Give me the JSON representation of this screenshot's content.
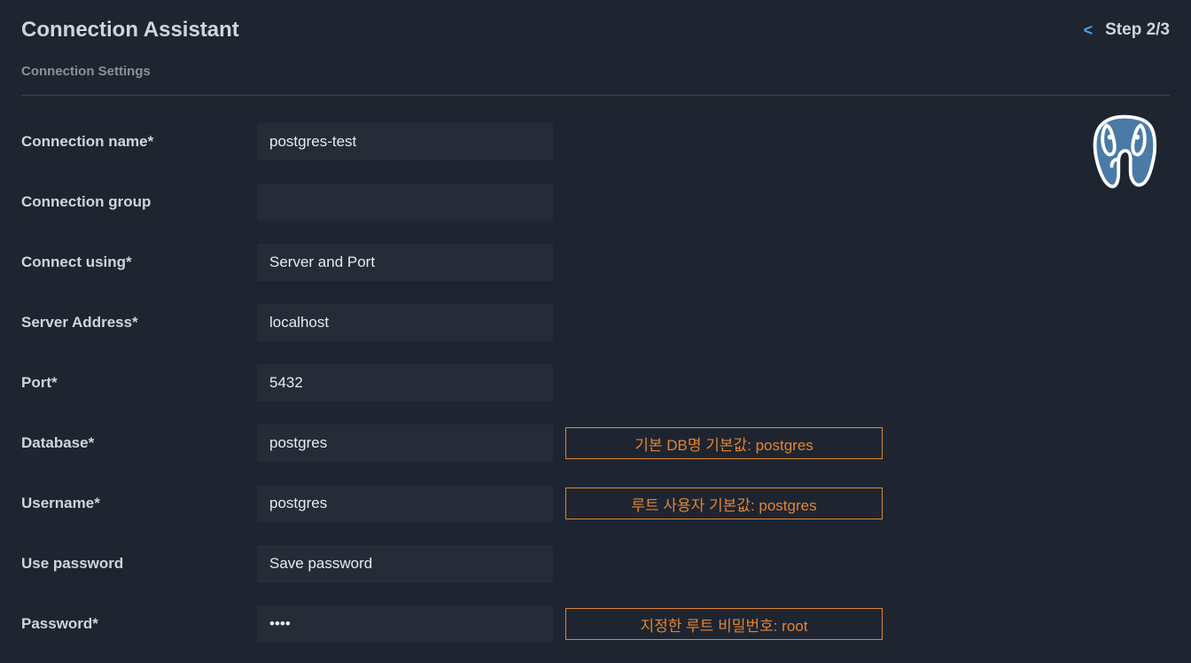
{
  "header": {
    "title": "Connection Assistant",
    "back_symbol": "<",
    "step_text": "Step 2/3"
  },
  "subtitle": "Connection Settings",
  "form": {
    "connection_name": {
      "label": "Connection name*",
      "value": "postgres-test"
    },
    "connection_group": {
      "label": "Connection group",
      "value": ""
    },
    "connect_using": {
      "label": "Connect using*",
      "value": "Server and Port"
    },
    "server_address": {
      "label": "Server Address*",
      "value": "localhost"
    },
    "port": {
      "label": "Port*",
      "value": "5432"
    },
    "database": {
      "label": "Database*",
      "value": "postgres",
      "annotation": "기본 DB명 기본값: postgres"
    },
    "username": {
      "label": "Username*",
      "value": "postgres",
      "annotation": "루트 사용자 기본값: postgres"
    },
    "use_password": {
      "label": "Use password",
      "value": "Save password"
    },
    "password": {
      "label": "Password*",
      "value": "root",
      "display": "••••",
      "annotation": "지정한 루트 비밀번호: root"
    }
  }
}
